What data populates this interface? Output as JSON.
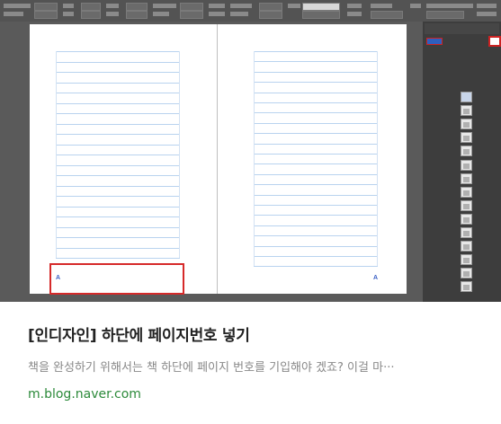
{
  "screenshot": {
    "left_page": {
      "page_marker": "A"
    },
    "right_page": {
      "page_marker": "A"
    }
  },
  "post": {
    "title": "[인디자인] 하단에 페이지번호 넣기",
    "description": "책을 완성하기 위해서는 책 하단에 페이지 번호를 기입해야 겠죠? 이걸 마···",
    "source": "m.blog.naver.com"
  },
  "colors": {
    "title": "#222222",
    "description": "#888888",
    "source": "#2c8a3a",
    "highlight": "#d62a2a",
    "guide_line": "#b9d3ef",
    "page_marker": "#3b61c5"
  }
}
